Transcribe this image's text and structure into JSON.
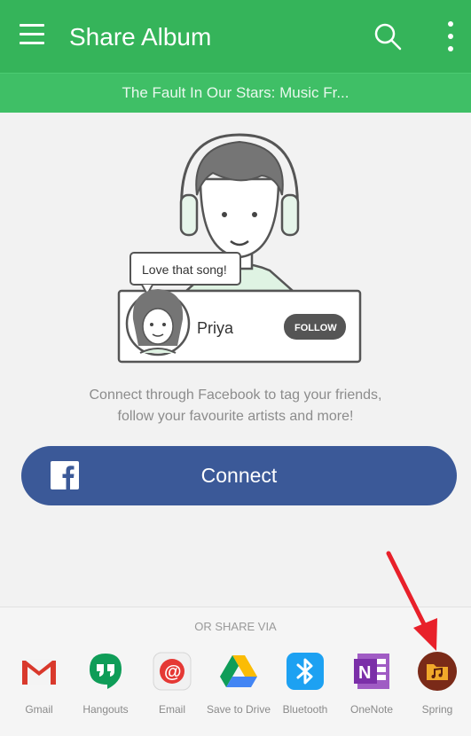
{
  "header": {
    "title": "Share Album",
    "subtitle": "The Fault In Our Stars: Music Fr...",
    "accent_color": "#35b45a",
    "menu_icon": "hamburger-menu-icon",
    "search_icon": "search-icon",
    "more_icon": "more-vert-icon"
  },
  "illustration": {
    "bubble_text": "Love that song!",
    "friend_name": "Priya",
    "follow_label": "FOLLOW"
  },
  "description": {
    "line1": "Connect through Facebook to tag your friends,",
    "line2": "follow your favourite artists and more!"
  },
  "connect": {
    "label": "Connect",
    "color": "#3b5998",
    "icon": "facebook-icon"
  },
  "share": {
    "heading": "OR SHARE VIA",
    "apps": [
      {
        "label": "Gmail",
        "icon": "gmail-icon"
      },
      {
        "label": "Hangouts",
        "icon": "hangouts-icon"
      },
      {
        "label": "Email",
        "icon": "email-icon"
      },
      {
        "label": "Save to Drive",
        "icon": "drive-icon"
      },
      {
        "label": "Bluetooth",
        "icon": "bluetooth-icon"
      },
      {
        "label": "OneNote",
        "icon": "onenote-icon"
      },
      {
        "label": "Spring",
        "icon": "spring-icon"
      }
    ]
  },
  "annotation": {
    "arrow_color": "#e8202a",
    "arrow_icon": "red-arrow-icon"
  }
}
